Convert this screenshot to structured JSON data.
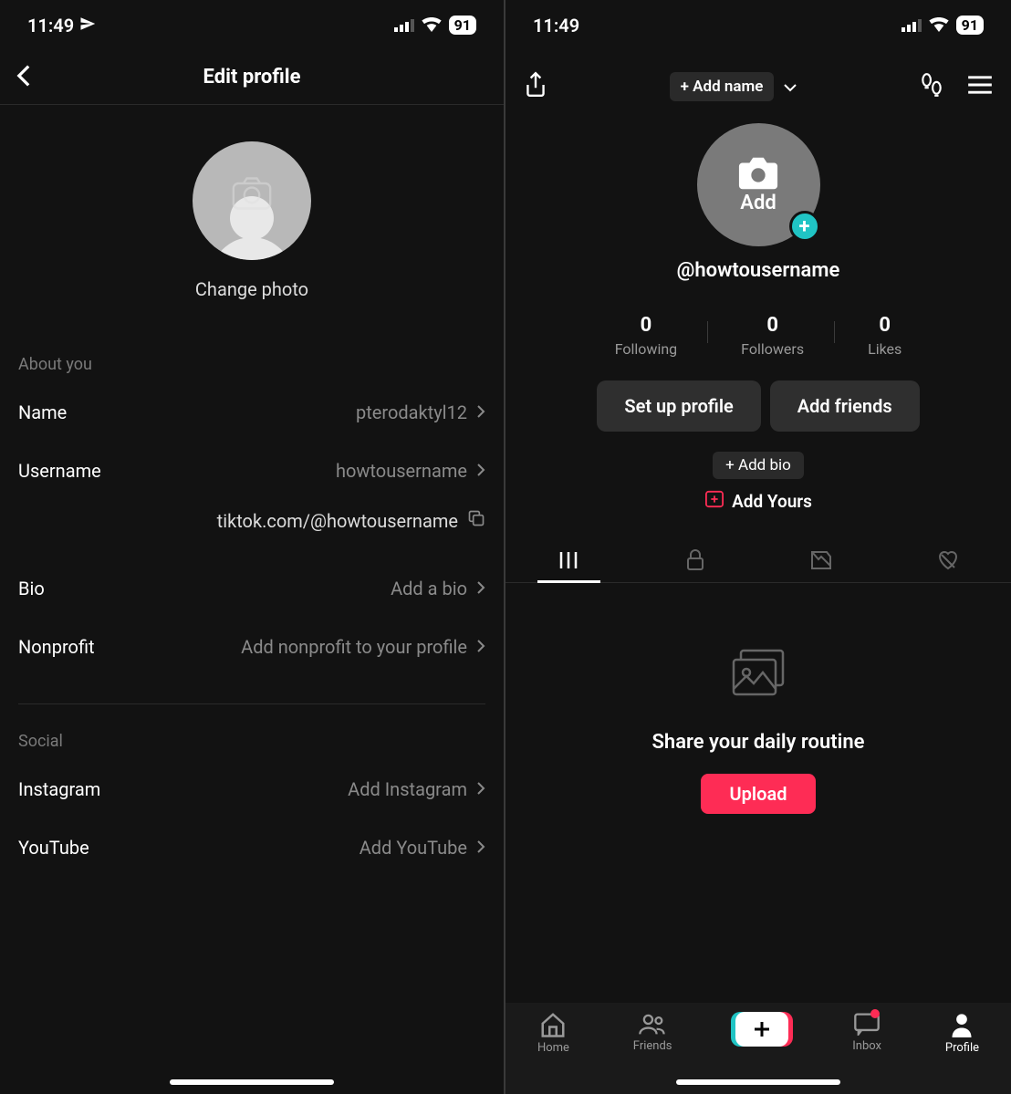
{
  "status": {
    "time": "11:49",
    "battery": "91"
  },
  "left": {
    "header_title": "Edit profile",
    "change_photo": "Change photo",
    "section_about": "About you",
    "name": {
      "label": "Name",
      "value": "pterodaktyl12"
    },
    "username": {
      "label": "Username",
      "value": "howtousername"
    },
    "url": "tiktok.com/@howtousername",
    "bio": {
      "label": "Bio",
      "value": "Add a bio"
    },
    "nonprofit": {
      "label": "Nonprofit",
      "value": "Add nonprofit to your profile"
    },
    "section_social": "Social",
    "instagram": {
      "label": "Instagram",
      "value": "Add Instagram"
    },
    "youtube": {
      "label": "YouTube",
      "value": "Add YouTube"
    }
  },
  "right": {
    "add_name": "+ Add name",
    "avatar_add": "Add",
    "username": "@howtousername",
    "stats": {
      "following": {
        "count": "0",
        "label": "Following"
      },
      "followers": {
        "count": "0",
        "label": "Followers"
      },
      "likes": {
        "count": "0",
        "label": "Likes"
      }
    },
    "setup_profile": "Set up profile",
    "add_friends": "Add friends",
    "add_bio": "+ Add bio",
    "add_yours": "Add Yours",
    "empty_title": "Share your daily routine",
    "upload": "Upload",
    "nav": {
      "home": "Home",
      "friends": "Friends",
      "inbox": "Inbox",
      "profile": "Profile"
    }
  }
}
